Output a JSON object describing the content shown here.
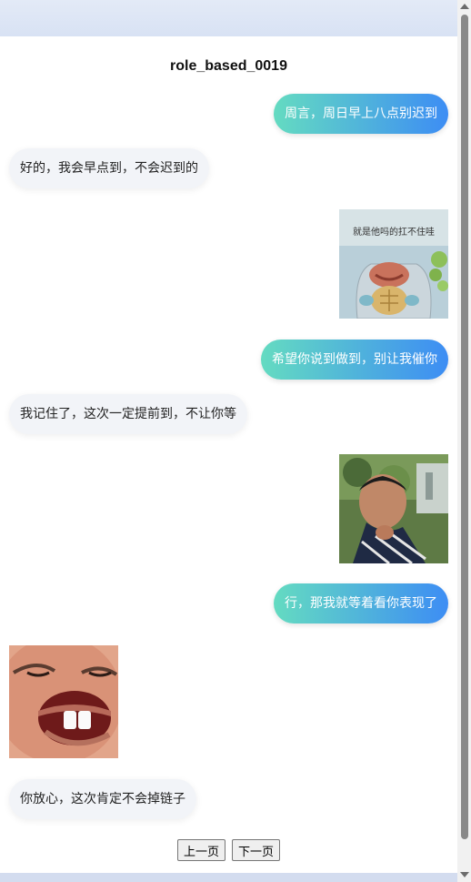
{
  "chat": {
    "title": "role_based_0019",
    "messages": [
      {
        "side": "right",
        "type": "text",
        "text": "周言，周日早上八点别迟到"
      },
      {
        "side": "left",
        "type": "text",
        "text": "好的，我会早点到，不会迟到的"
      },
      {
        "side": "right",
        "type": "image",
        "caption": "就是他吗的扛不住哇"
      },
      {
        "side": "right",
        "type": "text",
        "text": "希望你说到做到，别让我催你"
      },
      {
        "side": "left",
        "type": "text",
        "text": "我记住了，这次一定提前到，不让你等"
      },
      {
        "side": "right",
        "type": "image"
      },
      {
        "side": "right",
        "type": "text",
        "text": "行，那我就等着看你表现了"
      },
      {
        "side": "left",
        "type": "image"
      },
      {
        "side": "left",
        "type": "text",
        "text": "你放心，这次肯定不会掉链子"
      }
    ]
  },
  "pagination": {
    "prev_label": "上一页",
    "next_label": "下一页"
  },
  "colors": {
    "bubble_right_start": "#64dbc1",
    "bubble_right_end": "#3d8df4",
    "bubble_left": "#f2f4f8"
  }
}
